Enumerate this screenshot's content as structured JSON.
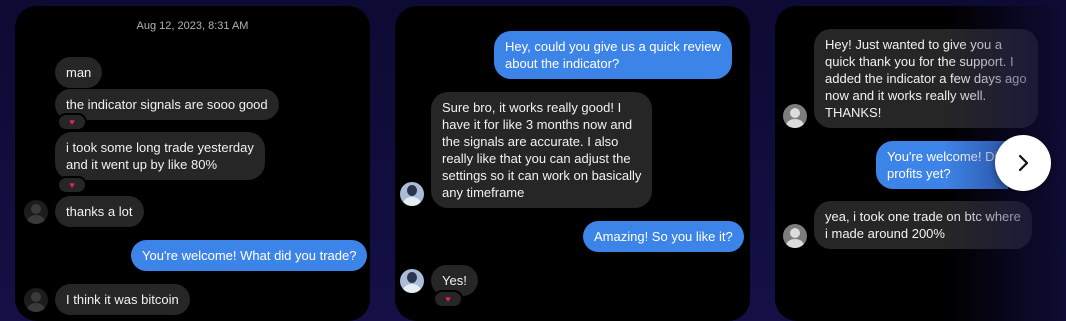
{
  "carousel": {
    "next_icon": "chevron-right-icon",
    "card1": {
      "timestamp": "Aug 12, 2023, 8:31 AM",
      "messages": [
        {
          "text": "man"
        },
        {
          "text": "the indicator signals are sooo good"
        },
        {
          "line1": "i took some long trade yesterday",
          "line2": "and it went up by like 80%"
        },
        {
          "text": "thanks a lot"
        },
        {
          "text": "You're welcome! What did you trade?"
        },
        {
          "text": "I think it was bitcoin"
        }
      ]
    },
    "card2": {
      "messages": [
        {
          "line1": "Hey, could you give us a quick review",
          "line2": "about the indicator?"
        },
        {
          "lines": [
            "Sure bro, it works really good! I",
            "have it for like 3 months now and",
            "the signals are accurate. I also",
            "really like that you can adjust the",
            "settings so it can work on basically",
            "any timeframe"
          ]
        },
        {
          "text": "Amazing! So you like it?"
        },
        {
          "text": "Yes!"
        }
      ]
    },
    "card3": {
      "messages": [
        {
          "lines": [
            "Hey! Just wanted to give you a",
            "quick thank you for the support. I",
            "added the indicator a few days ago",
            "now and it works really well.",
            "THANKS!"
          ]
        },
        {
          "line1": "You're welcome! Di",
          "line2": "profits yet?"
        },
        {
          "line1": "yea, i took one trade on btc where",
          "line2": "i made around 200%"
        }
      ]
    },
    "reaction_icon": "heart-icon",
    "colors": {
      "background": "#0d0a33",
      "card": "#000000",
      "incoming_bubble": "#262626",
      "outgoing_bubble": "#3d84e8",
      "reaction": "#e0245e"
    }
  }
}
